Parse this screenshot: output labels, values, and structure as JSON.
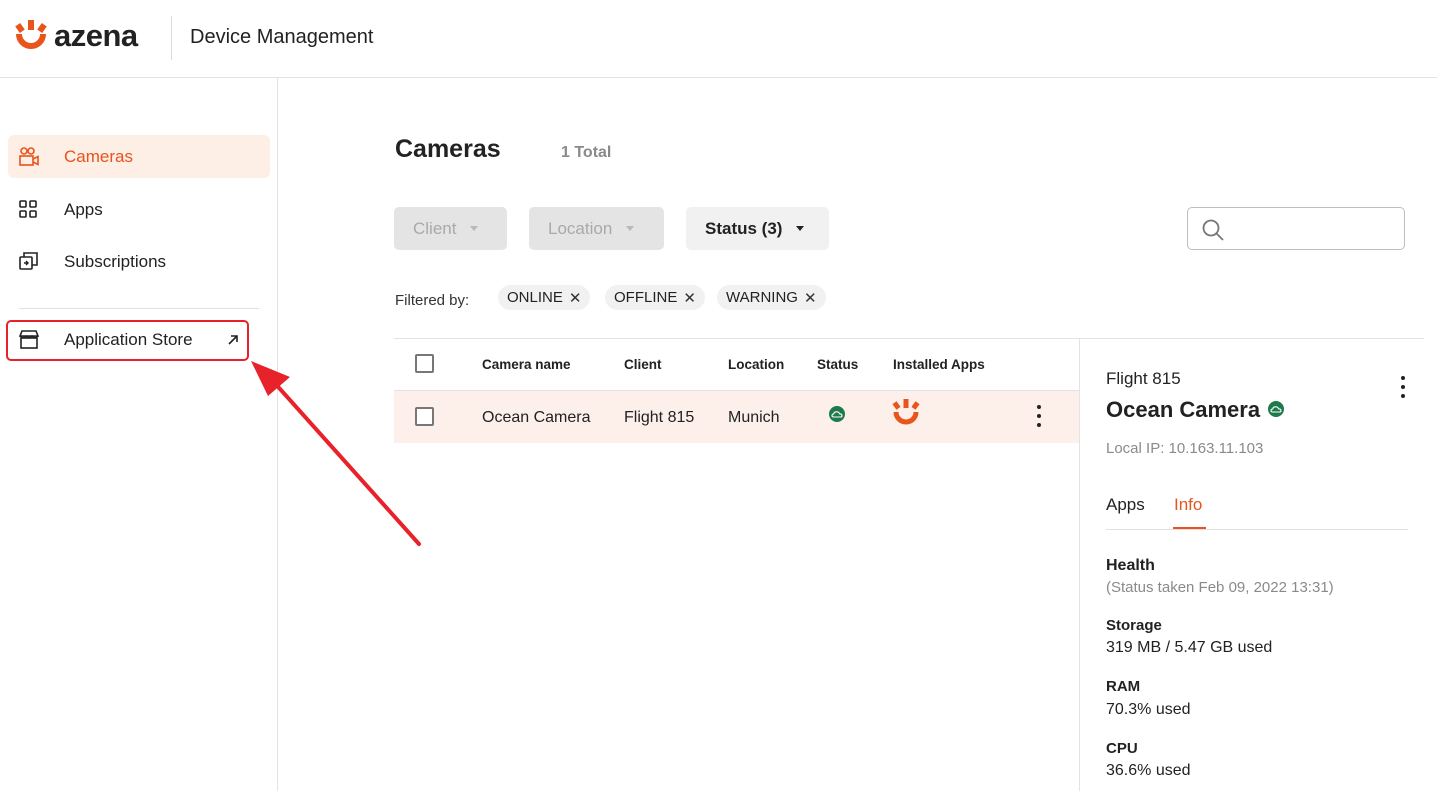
{
  "header": {
    "logo_text": "azena",
    "title": "Device Management",
    "brand_color": "#e8541b"
  },
  "sidebar": {
    "items": [
      {
        "label": "Cameras",
        "icon": "camera-icon",
        "active": true
      },
      {
        "label": "Apps",
        "icon": "grid-icon",
        "active": false
      },
      {
        "label": "Subscriptions",
        "icon": "subscriptions-icon",
        "active": false
      }
    ],
    "store": {
      "label": "Application Store",
      "icon": "store-icon",
      "external_icon": "external-link-icon"
    }
  },
  "main": {
    "title": "Cameras",
    "total": "1 Total",
    "filters": {
      "client": "Client",
      "location": "Location",
      "status": "Status (3)"
    },
    "search": {
      "placeholder": "",
      "value": ""
    },
    "filtered_by_label": "Filtered by:",
    "chips": [
      "ONLINE",
      "OFFLINE",
      "WARNING"
    ],
    "table": {
      "columns": [
        "Camera name",
        "Client",
        "Location",
        "Status",
        "Installed Apps"
      ],
      "rows": [
        {
          "camera_name": "Ocean Camera",
          "client": "Flight 815",
          "location": "Munich",
          "status": "online",
          "installed_apps": [
            "azena-app-icon"
          ]
        }
      ]
    }
  },
  "detail": {
    "client": "Flight 815",
    "name": "Ocean Camera",
    "local_ip": "Local IP:  10.163.11.103",
    "tabs": [
      "Apps",
      "Info"
    ],
    "active_tab": "Info",
    "health": {
      "label": "Health",
      "sub": "(Status taken Feb 09, 2022 13:31)"
    },
    "storage": {
      "label": "Storage",
      "value": "319 MB / 5.47 GB used"
    },
    "ram": {
      "label": "RAM",
      "value": "70.3% used"
    },
    "cpu": {
      "label": "CPU",
      "value": "36.6% used"
    }
  },
  "colors": {
    "accent": "#e8541b",
    "online": "#1e7a4a",
    "highlight": "#e8222a"
  }
}
